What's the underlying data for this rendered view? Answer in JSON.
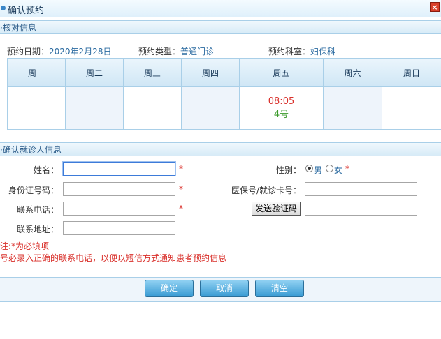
{
  "window": {
    "title": "确认预约",
    "close_label": "×"
  },
  "section1": {
    "title": "·核对信息"
  },
  "info": {
    "date_label": "预约日期：",
    "date_value": "2020年2月28日",
    "type_label": "预约类型：",
    "type_value": "普通门诊",
    "dept_label": "预约科室：",
    "dept_value": "妇保科"
  },
  "calendar": {
    "days": [
      "周一",
      "周二",
      "周三",
      "周四",
      "周五",
      "周六",
      "周日"
    ],
    "slot": {
      "day": "周五",
      "time": "08:05",
      "number": "4号"
    }
  },
  "section2": {
    "title": "·确认就诊人信息"
  },
  "form": {
    "name_label": "姓名：",
    "id_label": "身份证号码：",
    "phone_label": "联系电话：",
    "address_label": "联系地址：",
    "gender_label": "性别：",
    "gender_male": "男",
    "gender_female": "女",
    "gender_selected": "男",
    "insurance_label": "医保号/就诊卡号：",
    "verify_button": "发送验证码",
    "required_mark": "*"
  },
  "notes": {
    "line1": "注:*为必填项",
    "line2": "号必录入正确的联系电话，以便以短信方式通知患者预约信息"
  },
  "buttons": {
    "confirm": "确定",
    "cancel": "取消",
    "clear": "清空"
  },
  "colors": {
    "required": "#d9302b",
    "link_value": "#2a6aa0",
    "slot_time": "#d9302b",
    "slot_number": "#3a9a2a"
  }
}
